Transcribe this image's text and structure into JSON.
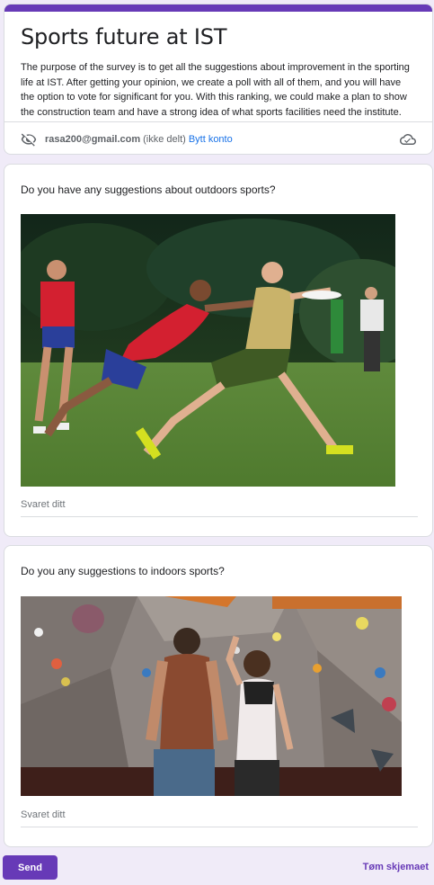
{
  "form": {
    "title": "Sports future at IST",
    "description": "The purpose of the survey is to get all the suggestions about improvement in the sporting life at IST. After getting your opinion, we create a poll with all of them, and you will have the option to vote for significant for you. With this ranking, we could make a plan to show the construction team and have a strong idea of what sports facilities need the institute.",
    "accent_color": "#673ab7"
  },
  "account": {
    "email": "rasa200@gmail.com",
    "note": "(ikke delt)",
    "switch_label": "Bytt konto",
    "left_icon": "eye-off-icon",
    "right_icon": "cloud-icon"
  },
  "questions": [
    {
      "title": "Do you have any suggestions about outdoors sports?",
      "image": "ultimate-frisbee-photo",
      "answer_placeholder": "Svaret ditt"
    },
    {
      "title": "Do you any suggestions to indoors sports?",
      "image": "climbing-wall-photo",
      "answer_placeholder": "Svaret ditt"
    }
  ],
  "footer": {
    "send_label": "Send",
    "clear_label": "Tøm skjemaet"
  }
}
